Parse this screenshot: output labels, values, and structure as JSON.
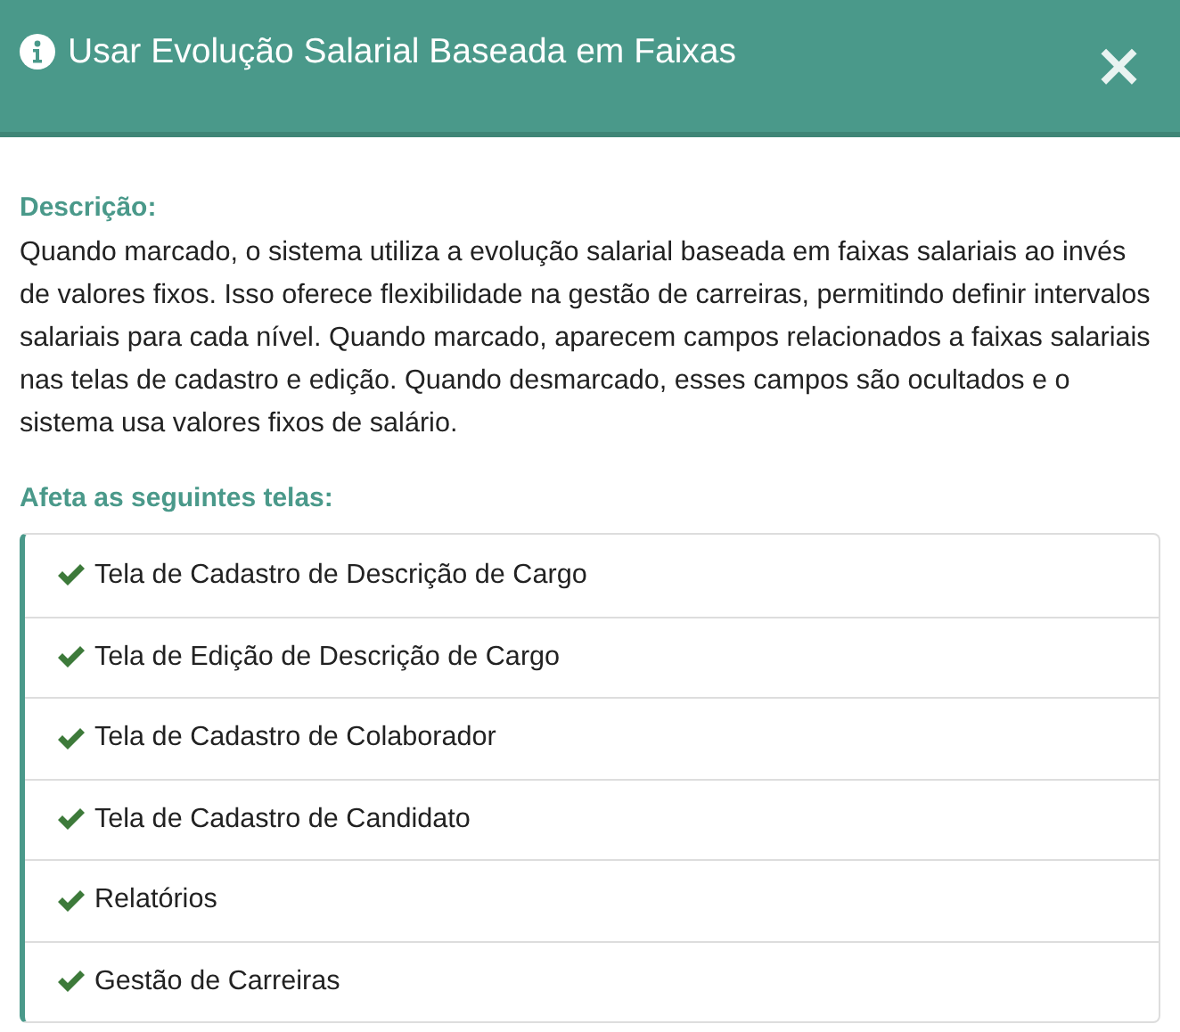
{
  "dialog": {
    "title": "Usar Evolução Salarial Baseada em Faixas",
    "close": "×"
  },
  "description": {
    "heading": "Descrição:",
    "text": "Quando marcado, o sistema utiliza a evolução salarial baseada em faixas salariais ao invés de valores fixos. Isso oferece flexibilidade na gestão de carreiras, permitindo definir intervalos salariais para cada nível. Quando marcado, aparecem campos relacionados a faixas salariais nas telas de cadastro e edição. Quando desmarcado, esses campos são ocultados e o sistema usa valores fixos de salário."
  },
  "affected": {
    "heading": "Afeta as seguintes telas:",
    "items": [
      {
        "label": "Tela de Cadastro de Descrição de Cargo"
      },
      {
        "label": "Tela de Edição de Descrição de Cargo"
      },
      {
        "label": "Tela de Cadastro de Colaborador"
      },
      {
        "label": "Tela de Cadastro de Candidato"
      },
      {
        "label": "Relatórios"
      },
      {
        "label": "Gestão de Carreiras"
      }
    ]
  }
}
